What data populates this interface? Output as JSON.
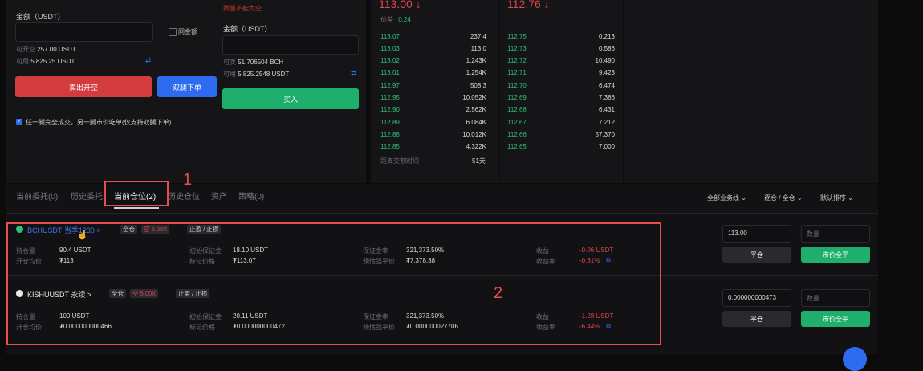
{
  "left_form": {
    "amount_label": "金额（USDT）",
    "same_amount_label": "同金额",
    "open_short_avail_label": "可开空",
    "open_short_avail_value": "257.00 USDT",
    "available_label": "可用",
    "available_value": "5,825.25 USDT",
    "sell_open_short_button": "卖出开空",
    "dual_leg_button": "双腿下单",
    "checkbox_label": "任一腿完全成交，另一腿市价吃单(仅支持双腿下单)"
  },
  "mid_form": {
    "error_text": "数量不能为空",
    "amount_label": "金额（USDT）",
    "sellable_label": "可卖",
    "sellable_value": "51.706504 BCH",
    "available_label": "可用",
    "available_value": "5,825.2548 USDT",
    "buy_button": "买入"
  },
  "orderbook": {
    "price_left": "113.00 ↓",
    "price_right": "112.76 ↓",
    "spread_label": "价差",
    "spread_value": "0.24",
    "rows": [
      {
        "bp": "113.07",
        "bq": "237.4",
        "ap": "112.75",
        "aq": "0.213"
      },
      {
        "bp": "113.03",
        "bq": "113.0",
        "ap": "112.73",
        "aq": "0.586"
      },
      {
        "bp": "113.02",
        "bq": "1.243K",
        "ap": "112.72",
        "aq": "10.490"
      },
      {
        "bp": "113.01",
        "bq": "1.254K",
        "ap": "112.71",
        "aq": "9.423"
      },
      {
        "bp": "112.97",
        "bq": "508.3",
        "ap": "112.70",
        "aq": "6.474"
      },
      {
        "bp": "112.95",
        "bq": "10.052K",
        "ap": "112.69",
        "aq": "7.386"
      },
      {
        "bp": "112.90",
        "bq": "2.562K",
        "ap": "112.68",
        "aq": "6.431"
      },
      {
        "bp": "112.89",
        "bq": "6.084K",
        "ap": "112.67",
        "aq": "7.212"
      },
      {
        "bp": "112.88",
        "bq": "10.012K",
        "ap": "112.66",
        "aq": "57.370"
      },
      {
        "bp": "112.85",
        "bq": "4.322K",
        "ap": "112.65",
        "aq": "7.000"
      }
    ],
    "delivery_label": "距离交割时间",
    "delivery_value": "51天"
  },
  "tabs": {
    "items": [
      "当前委托(0)",
      "历史委托",
      "当前仓位(2)",
      "历史仓位",
      "资产",
      "策略(0)"
    ],
    "filter_all_types": "全部业务线 ⌄",
    "filter_mode": "逐仓 / 全仓 ⌄",
    "filter_sort": "默认排序 ⌄"
  },
  "positions": [
    {
      "symbol": "BCHUSDT 当季1230 >",
      "mode_tag": "全仓",
      "leverage_tag": "空 5.00X",
      "tpsl_tag": "止盈 / 止损",
      "labels": [
        "持仓量",
        "开仓均价",
        "初始保证金",
        "标记价格",
        "保证金率",
        "预估强平价",
        "收益",
        "收益率"
      ],
      "size": "90.4 USDT",
      "entry": "₮113",
      "init_margin": "18.10 USDT",
      "mark_price": "₮113.07",
      "margin_ratio": "321,373.50%",
      "liq_price": "₮7,378.38",
      "pnl": "-0.06 USDT",
      "pnl_rate": "-0.31%",
      "price_input": "113.00",
      "qty_placeholder": "数量",
      "close_button": "平仓",
      "market_close_button": "市价全平"
    },
    {
      "symbol": "KISHUUSDT 永续 >",
      "mode_tag": "全仓",
      "leverage_tag": "空 5.00X",
      "tpsl_tag": "止盈 / 止损",
      "labels": [
        "持仓量",
        "开仓均价",
        "初始保证金",
        "标记价格",
        "保证金率",
        "预估强平价",
        "收益",
        "收益率"
      ],
      "size": "100 USDT",
      "entry": "₮0.000000000466",
      "init_margin": "20.11 USDT",
      "mark_price": "₮0.000000000472",
      "margin_ratio": "321,373.50%",
      "liq_price": "₮0.000000027706",
      "pnl": "-1.28 USDT",
      "pnl_rate": "-6.44%",
      "price_input": "0.000000000473",
      "qty_placeholder": "数量",
      "close_button": "平仓",
      "market_close_button": "市价全平"
    }
  ],
  "annotations": {
    "one": "1",
    "two": "2"
  },
  "colors": {
    "accent_red": "#e0454a",
    "accent_green": "#2fbf7a",
    "accent_blue": "#2d6cf0",
    "annotation": "#e84e4e"
  }
}
